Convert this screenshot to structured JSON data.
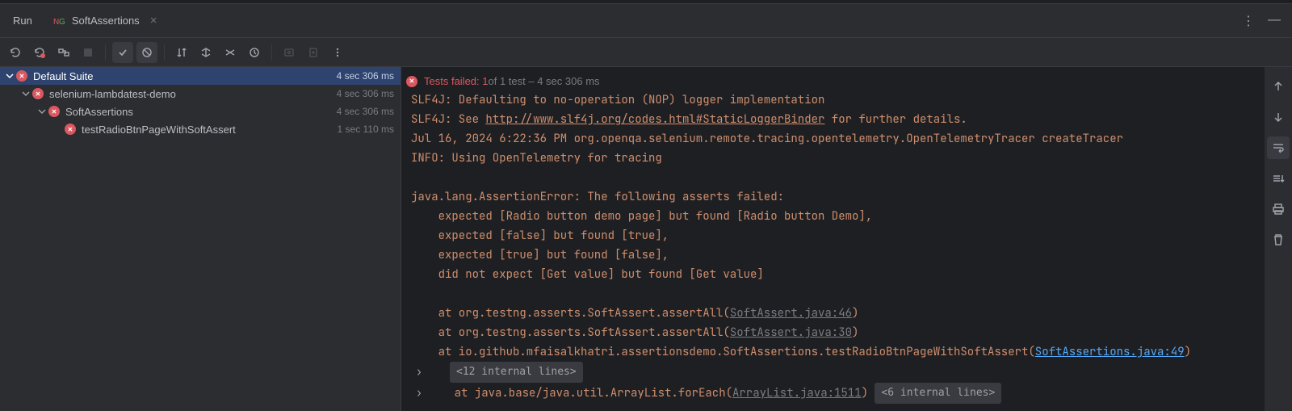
{
  "tabBar": {
    "runLabel": "Run",
    "activeTab": "SoftAssertions"
  },
  "tree": {
    "suite": {
      "label": "Default Suite",
      "time": "4 sec 306 ms"
    },
    "module": {
      "label": "selenium-lambdatest-demo",
      "time": "4 sec 306 ms"
    },
    "class": {
      "label": "SoftAssertions",
      "time": "4 sec 306 ms"
    },
    "test": {
      "label": "testRadioBtnPageWithSoftAssert",
      "time": "1 sec 110 ms"
    }
  },
  "status": {
    "failLabel": "Tests failed: 1",
    "rest": " of 1 test – 4 sec 306 ms"
  },
  "console": {
    "l1a": "SLF4J: Defaulting to no-operation (NOP) logger implementation",
    "l2a": "SLF4J: See ",
    "l2link": "http://www.slf4j.org/codes.html#StaticLoggerBinder",
    "l2b": " for further details.",
    "l3": "Jul 16, 2024 6:22:36 PM org.openqa.selenium.remote.tracing.opentelemetry.OpenTelemetryTracer createTracer",
    "l4": "INFO: Using OpenTelemetry for tracing",
    "l5": "java.lang.AssertionError: The following asserts failed:",
    "l6": "    expected [Radio button demo page] but found [Radio button Demo],",
    "l7": "    expected [false] but found [true],",
    "l8": "    expected [true] but found [false],",
    "l9": "    did not expect [Get value] but found [Get value]",
    "st1a": "    at org.testng.asserts.SoftAssert.assertAll(",
    "st1link": "SoftAssert.java:46",
    "st1b": ")",
    "st2a": "    at org.testng.asserts.SoftAssert.assertAll(",
    "st2link": "SoftAssert.java:30",
    "st2b": ")",
    "st3a": "    at io.github.mfaisalkhatri.assertionsdemo.SoftAssertions.testRadioBtnPageWithSoftAssert(",
    "st3link": "SoftAssertions.java:49",
    "st3b": ")",
    "fold1": "<12 internal lines>",
    "st4a": "    at java.base/java.util.ArrayList.forEach(",
    "st4link": "ArrayList.java:1511",
    "st4b": ") ",
    "fold2": "<6 internal lines>"
  }
}
